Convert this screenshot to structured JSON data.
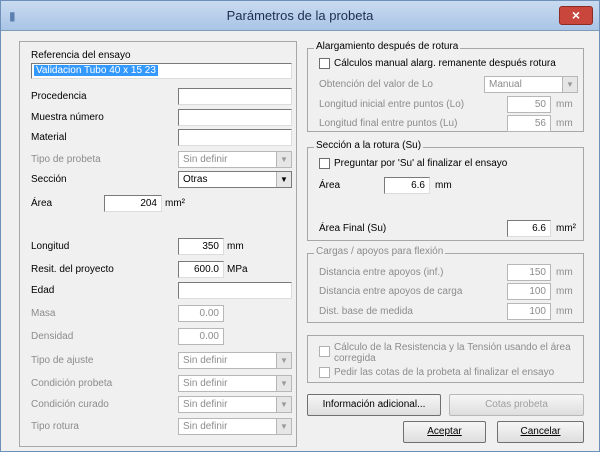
{
  "window": {
    "title": "Parámetros de la probeta",
    "close_label": "×"
  },
  "left": {
    "referencia_label": "Referencia del ensayo",
    "referencia_value": "Validacion Tubo 40 x 15 23",
    "procedencia_label": "Procedencia",
    "muestra_label": "Muestra número",
    "material_label": "Material",
    "tipo_probeta_label": "Tipo de probeta",
    "tipo_probeta_value": "Sin definir",
    "seccion_label": "Sección",
    "seccion_value": "Otras",
    "area_label": "Área",
    "area_value": "204",
    "area_unit": "mm²",
    "longitud_label": "Longitud",
    "longitud_value": "350",
    "longitud_unit": "mm",
    "resist_label": "Resit. del proyecto",
    "resist_value": "600.0",
    "resist_unit": "MPa",
    "edad_label": "Edad",
    "masa_label": "Masa",
    "masa_value": "0.00",
    "densidad_label": "Densidad",
    "densidad_value": "0.00",
    "tipo_ajuste_label": "Tipo de ajuste",
    "tipo_ajuste_value": "Sin definir",
    "condicion_probeta_label": "Condición probeta",
    "condicion_probeta_value": "Sin definir",
    "condicion_curado_label": "Condición curado",
    "condicion_curado_value": "Sin definir",
    "tipo_rotura_label": "Tipo rotura",
    "tipo_rotura_value": "Sin definir"
  },
  "alarg": {
    "title": "Alargamiento después de rotura",
    "check_label": "Cálculos manual alarg. remanente después rotura",
    "obtencion_label": "Obtención del valor de Lo",
    "obtencion_value": "Manual",
    "long_inicial_label": "Longitud inicial entre puntos (Lo)",
    "long_inicial_value": "50",
    "long_inicial_unit": "mm",
    "long_final_label": "Longitud final entre puntos (Lu)",
    "long_final_value": "56",
    "long_final_unit": "mm"
  },
  "seccion": {
    "title": "Sección a la rotura (Su)",
    "check_label": "Preguntar por 'Su' al finalizar el ensayo",
    "area_label": "Área",
    "area_value": "6.6",
    "area_unit": "mm",
    "area_final_label": "Área Final (Su)",
    "area_final_value": "6.6",
    "area_final_unit": "mm²"
  },
  "cargas": {
    "title": "Cargas / apoyos para flexión",
    "dist_apoyos_label": "Distancia entre apoyos (inf.)",
    "dist_apoyos_value": "150",
    "dist_apoyos_unit": "mm",
    "dist_carga_label": "Distancia entre apoyos de carga",
    "dist_carga_value": "100",
    "dist_carga_unit": "mm",
    "dist_base_label": "Dist. base de medida",
    "dist_base_value": "100",
    "dist_base_unit": "mm"
  },
  "calc": {
    "check1_line1": "Cálculo de la Resistencia y la Tensión usando el área",
    "check1_line2": "corregida",
    "check2_label": "Pedir las cotas de la probeta al finalizar el ensayo"
  },
  "buttons": {
    "info_adicional": "Información adicional...",
    "cotas_probeta": "Cotas probeta",
    "aceptar": "Aceptar",
    "cancelar": "Cancelar"
  }
}
